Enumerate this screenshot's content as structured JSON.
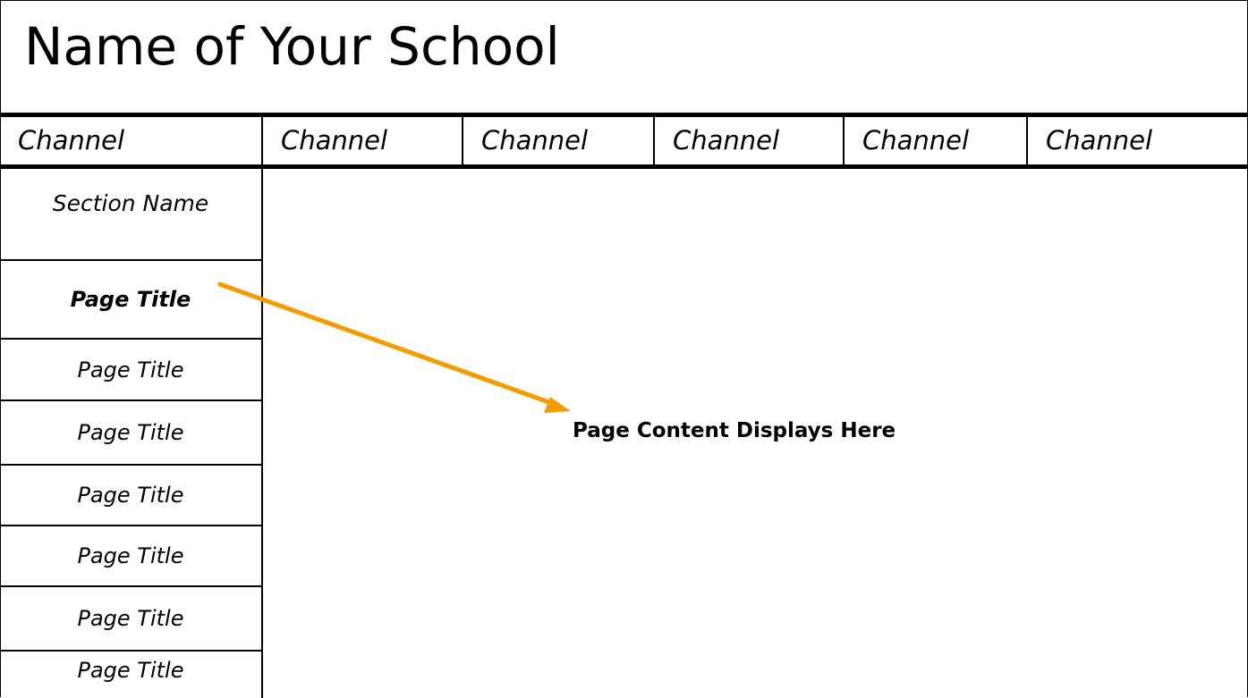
{
  "header": {
    "school_name": "Name of Your School"
  },
  "channels": [
    {
      "label": "Channel"
    },
    {
      "label": "Channel"
    },
    {
      "label": "Channel"
    },
    {
      "label": "Channel"
    },
    {
      "label": "Channel"
    },
    {
      "label": "Channel"
    }
  ],
  "sidebar": {
    "section_name": "Section Name",
    "pages": [
      {
        "label": "Page Title",
        "active": true
      },
      {
        "label": "Page Title"
      },
      {
        "label": "Page Title"
      },
      {
        "label": "Page Title"
      },
      {
        "label": "Page Title"
      },
      {
        "label": "Page Title"
      },
      {
        "label": "Page Title"
      }
    ]
  },
  "content": {
    "placeholder": "Page Content Displays Here"
  },
  "colors": {
    "arrow": "#f59b00",
    "lines": "#000000",
    "background": "#ffffff"
  }
}
